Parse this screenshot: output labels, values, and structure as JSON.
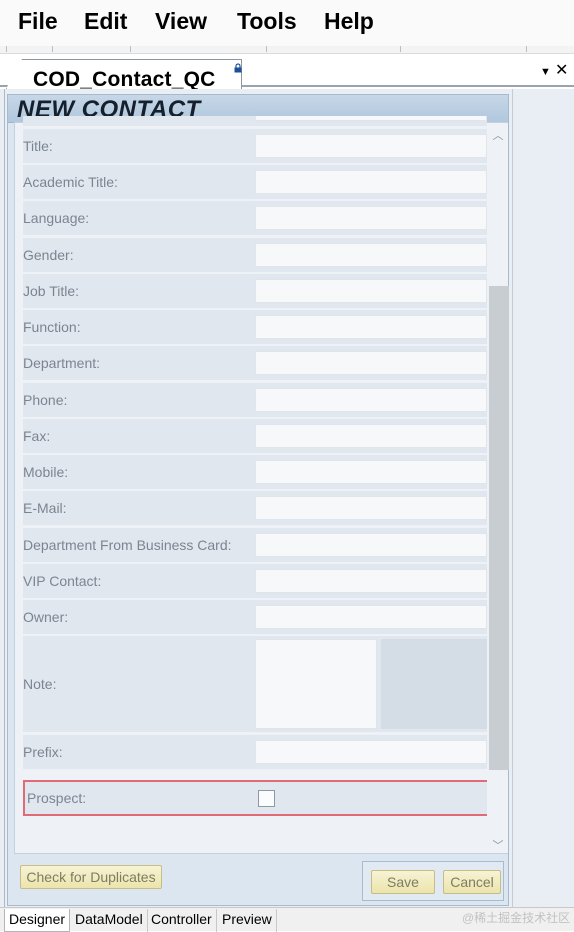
{
  "menu": {
    "items": [
      {
        "label": "File"
      },
      {
        "label": "Edit"
      },
      {
        "label": "View"
      },
      {
        "label": "Tools"
      },
      {
        "label": "Help"
      }
    ]
  },
  "document_tab": {
    "label": "COD_Contact_QC",
    "locked": true
  },
  "form": {
    "title": "NEW CONTACT",
    "fields": [
      {
        "label": "Title:"
      },
      {
        "label": "Academic Title:"
      },
      {
        "label": "Language:"
      },
      {
        "label": "Gender:"
      },
      {
        "label": "Job Title:"
      },
      {
        "label": "Function:"
      },
      {
        "label": "Department:"
      },
      {
        "label": "Phone:"
      },
      {
        "label": "Fax:"
      },
      {
        "label": "Mobile:"
      },
      {
        "label": "E-Mail:"
      },
      {
        "label": "Department From Business Card:"
      },
      {
        "label": "VIP Contact:"
      },
      {
        "label": "Owner:"
      }
    ],
    "note": {
      "label": "Note:"
    },
    "prefix": {
      "label": "Prefix:"
    },
    "prospect": {
      "label": "Prospect:",
      "checked": false
    }
  },
  "footer": {
    "check_duplicates_label": "Check for Duplicates",
    "save_label": "Save",
    "cancel_label": "Cancel"
  },
  "bottom_tabs": [
    {
      "label": "Designer",
      "active": true
    },
    {
      "label": "DataModel",
      "active": false
    },
    {
      "label": "Controller",
      "active": false
    },
    {
      "label": "Preview",
      "active": false
    }
  ],
  "watermark": "@稀土掘金技术社区"
}
